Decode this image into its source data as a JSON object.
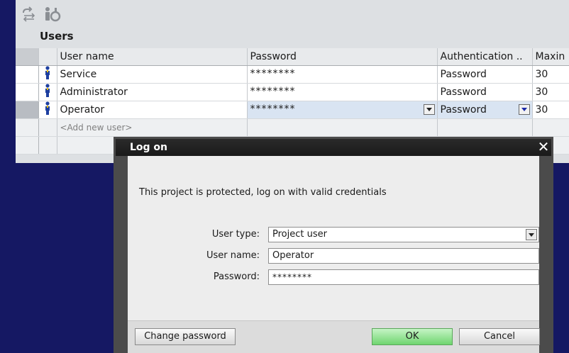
{
  "toolbar": {
    "icons": [
      "sync-users-icon",
      "user-info-icon"
    ]
  },
  "users_section": {
    "title": "Users",
    "columns": [
      "User name",
      "Password",
      "Authentication ..",
      "Maxin"
    ],
    "rows": [
      {
        "name": "Service",
        "password": "********",
        "auth": "Password",
        "max": "30"
      },
      {
        "name": "Administrator",
        "password": "********",
        "auth": "Password",
        "max": "30"
      },
      {
        "name": "Operator",
        "password": "********",
        "auth": "Password",
        "max": "30"
      }
    ],
    "add_new": "<Add new user>"
  },
  "dialog": {
    "title": "Log on",
    "close": "✕",
    "message": "This project is protected, log on with valid credentials",
    "user_type_label": "User type:",
    "user_type_value": "Project user",
    "user_name_label": "User name:",
    "user_name_value": "Operator",
    "password_label": "Password:",
    "password_value": "********",
    "change_password": "Change password",
    "ok": "OK",
    "cancel": "Cancel"
  },
  "colors": {
    "background": "#151863",
    "ok_button": "#6fd56f",
    "dialog_title": "#1a1a1a"
  }
}
